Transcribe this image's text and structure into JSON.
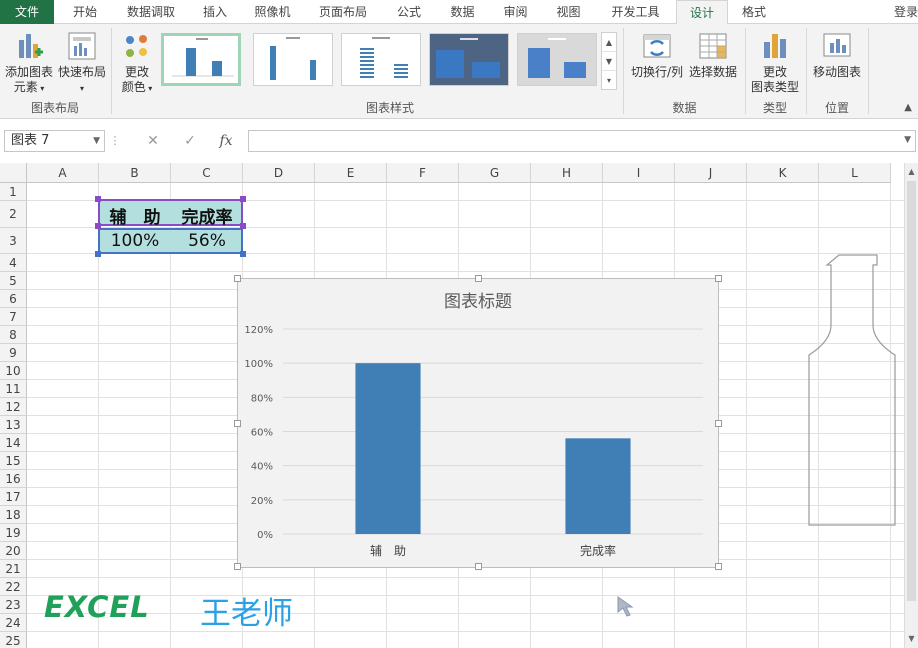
{
  "tabs": [
    {
      "label": "文件",
      "type": "file"
    },
    {
      "label": "开始"
    },
    {
      "label": "数据调取"
    },
    {
      "label": "插入"
    },
    {
      "label": "照像机"
    },
    {
      "label": "页面布局"
    },
    {
      "label": "公式"
    },
    {
      "label": "数据"
    },
    {
      "label": "审阅"
    },
    {
      "label": "视图"
    },
    {
      "label": "开发工具"
    },
    {
      "label": "设计",
      "active": true
    },
    {
      "label": "格式"
    }
  ],
  "login_label": "登录",
  "ribbon": {
    "add_element_line1": "添加图表",
    "add_element_line2": "元素",
    "quick_layout": "快速布局",
    "change_color_line1": "更改",
    "change_color_line2": "颜色",
    "switch_row_col": "切换行/列",
    "select_data": "选择数据",
    "change_type_line1": "更改",
    "change_type_line2": "图表类型",
    "move_chart": "移动图表",
    "groups": {
      "layout": "图表布局",
      "styles": "图表样式",
      "data": "数据",
      "type": "类型",
      "location": "位置"
    }
  },
  "formula_bar": {
    "name_box": "图表 7",
    "fx": "fx",
    "cancel": "✕",
    "enter": "✓",
    "value": ""
  },
  "sheet": {
    "columns": [
      "A",
      "B",
      "C",
      "D",
      "E",
      "F",
      "G",
      "H",
      "I",
      "J",
      "K",
      "L"
    ],
    "rows": [
      "1",
      "2",
      "3",
      "4",
      "5",
      "6",
      "7",
      "8",
      "9",
      "10",
      "11",
      "12",
      "13",
      "14",
      "15",
      "16",
      "17",
      "18",
      "19",
      "20",
      "21",
      "22",
      "23",
      "24",
      "25"
    ],
    "table": {
      "header": [
        "辅　助",
        "完成率"
      ],
      "values": [
        "100%",
        "56%"
      ]
    }
  },
  "colors": {
    "bar": "#3f7fb5",
    "table_fill": "#b3e0df",
    "selection_purple": "#8a4bc9",
    "selection_blue": "#4472c4",
    "excel_green": "#217346"
  },
  "chart_data": {
    "type": "bar",
    "title": "图表标题",
    "categories": [
      "辅　助",
      "完成率"
    ],
    "values": [
      100,
      56
    ],
    "ylim": [
      0,
      120
    ],
    "yticks": [
      0,
      20,
      40,
      60,
      80,
      100,
      120
    ],
    "ytick_labels": [
      "0%",
      "20%",
      "40%",
      "60%",
      "80%",
      "100%",
      "120%"
    ],
    "grid": true,
    "legend": "none"
  },
  "watermark": {
    "brand": "EXCEL",
    "teacher": "王老师"
  }
}
